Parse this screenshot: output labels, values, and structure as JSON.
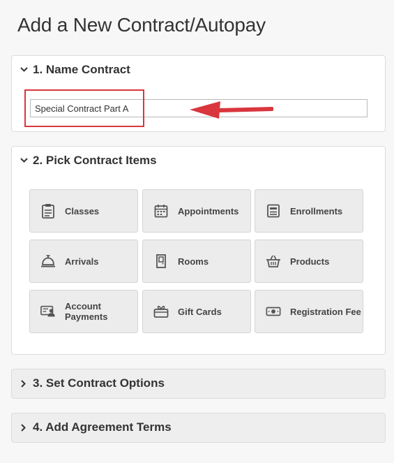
{
  "page": {
    "title": "Add a New Contract/Autopay"
  },
  "sections": {
    "name_contract": {
      "label": "1. Name Contract",
      "input_value": "Special Contract Part A"
    },
    "pick_items": {
      "label": "2. Pick Contract Items",
      "tiles": [
        {
          "label": "Classes",
          "icon": "clipboard-icon"
        },
        {
          "label": "Appointments",
          "icon": "calendar-icon"
        },
        {
          "label": "Enrollments",
          "icon": "enrollment-list-icon"
        },
        {
          "label": "Arrivals",
          "icon": "service-bell-icon"
        },
        {
          "label": "Rooms",
          "icon": "door-icon"
        },
        {
          "label": "Products",
          "icon": "basket-icon"
        },
        {
          "label": "Account Payments",
          "icon": "account-card-icon"
        },
        {
          "label": "Gift Cards",
          "icon": "gift-card-icon"
        },
        {
          "label": "Registration Fee",
          "icon": "cash-icon"
        }
      ]
    },
    "contract_options": {
      "label": "3. Set Contract Options"
    },
    "agreement_terms": {
      "label": "4. Add Agreement Terms"
    }
  },
  "colors": {
    "highlight": "#d9363e",
    "tile_bg": "#ececec",
    "panel_border": "#dcdcdc"
  }
}
